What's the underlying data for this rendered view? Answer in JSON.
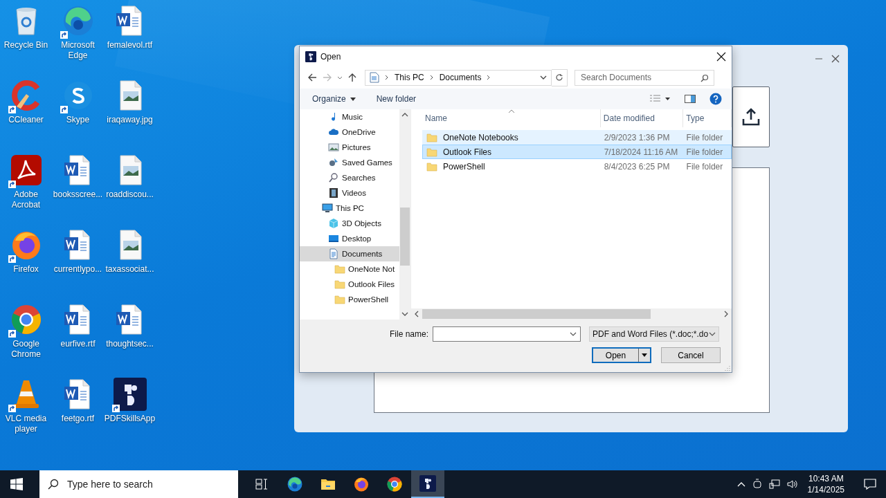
{
  "desktop_icons": [
    {
      "label": "Recycle Bin",
      "kind": "recycle",
      "shortcut": false
    },
    {
      "label": "Microsoft Edge",
      "kind": "edge",
      "shortcut": true
    },
    {
      "label": "femalevol.rtf",
      "kind": "word",
      "shortcut": false
    },
    {
      "label": "CCleaner",
      "kind": "ccleaner",
      "shortcut": true
    },
    {
      "label": "Skype",
      "kind": "skype",
      "shortcut": true
    },
    {
      "label": "iraqaway.jpg",
      "kind": "image",
      "shortcut": false
    },
    {
      "label": "Adobe Acrobat",
      "kind": "acrobat",
      "shortcut": true
    },
    {
      "label": "booksscree...",
      "kind": "word",
      "shortcut": false
    },
    {
      "label": "roaddiscou...",
      "kind": "image",
      "shortcut": false
    },
    {
      "label": "Firefox",
      "kind": "firefox",
      "shortcut": true
    },
    {
      "label": "currentlypo...",
      "kind": "word",
      "shortcut": false
    },
    {
      "label": "taxassociat...",
      "kind": "image",
      "shortcut": false
    },
    {
      "label": "Google Chrome",
      "kind": "chrome",
      "shortcut": true
    },
    {
      "label": "eurfive.rtf",
      "kind": "word",
      "shortcut": false
    },
    {
      "label": "thoughtsec...",
      "kind": "word",
      "shortcut": false
    },
    {
      "label": "VLC media player",
      "kind": "vlc",
      "shortcut": true
    },
    {
      "label": "feetgo.rtf",
      "kind": "word",
      "shortcut": false
    },
    {
      "label": "PDFSkillsApp",
      "kind": "pdfskills",
      "shortcut": true
    }
  ],
  "dialog": {
    "title": "Open",
    "address": [
      "This PC",
      "Documents"
    ],
    "search": {
      "placeholder": "Search Documents"
    },
    "toolbar": {
      "organize": "Organize",
      "new_folder": "New folder"
    },
    "nav_pane": {
      "items": [
        {
          "label": "Music",
          "kind": "music",
          "selected": false
        },
        {
          "label": "OneDrive",
          "kind": "cloud",
          "selected": false
        },
        {
          "label": "Pictures",
          "kind": "pictures",
          "selected": false
        },
        {
          "label": "Saved Games",
          "kind": "games",
          "selected": false
        },
        {
          "label": "Searches",
          "kind": "search",
          "selected": false
        },
        {
          "label": "Videos",
          "kind": "videos",
          "selected": false
        }
      ],
      "tree": [
        {
          "label": "This PC",
          "kind": "pc",
          "selected": false,
          "children": [
            {
              "label": "3D Objects",
              "kind": "cube",
              "selected": false
            },
            {
              "label": "Desktop",
              "kind": "desktop",
              "selected": false
            },
            {
              "label": "Documents",
              "kind": "documents",
              "selected": true,
              "children": [
                {
                  "label": "OneNote Not",
                  "kind": "folder",
                  "selected": false
                },
                {
                  "label": "Outlook Files",
                  "kind": "folder",
                  "selected": false
                },
                {
                  "label": "PowerShell",
                  "kind": "folder",
                  "selected": false
                }
              ]
            }
          ]
        }
      ]
    },
    "file_list": {
      "columns": [
        "Name",
        "Date modified",
        "Type"
      ],
      "rows": [
        {
          "name": "OneNote Notebooks",
          "date": "2/9/2023 1:36 PM",
          "type": "File folder",
          "selected": false,
          "hovered": true
        },
        {
          "name": "Outlook Files",
          "date": "7/18/2024 11:16 AM",
          "type": "File folder",
          "selected": true,
          "hovered": false
        },
        {
          "name": "PowerShell",
          "date": "8/4/2023 6:25 PM",
          "type": "File folder",
          "selected": false,
          "hovered": false
        }
      ]
    },
    "file_name": {
      "label": "File name:"
    },
    "file_type": "PDF and Word Files (*.doc;*.do",
    "buttons": {
      "open": "Open",
      "cancel": "Cancel"
    }
  },
  "taskbar": {
    "search": {
      "placeholder": "Type here to search"
    },
    "apps": [
      {
        "kind": "edge",
        "active": false
      },
      {
        "kind": "explorer",
        "active": false
      },
      {
        "kind": "firefox",
        "active": false
      },
      {
        "kind": "chrome",
        "active": false
      },
      {
        "kind": "pdfskills",
        "active": true
      }
    ],
    "time": "10:43 AM",
    "date": "1/14/2025"
  }
}
